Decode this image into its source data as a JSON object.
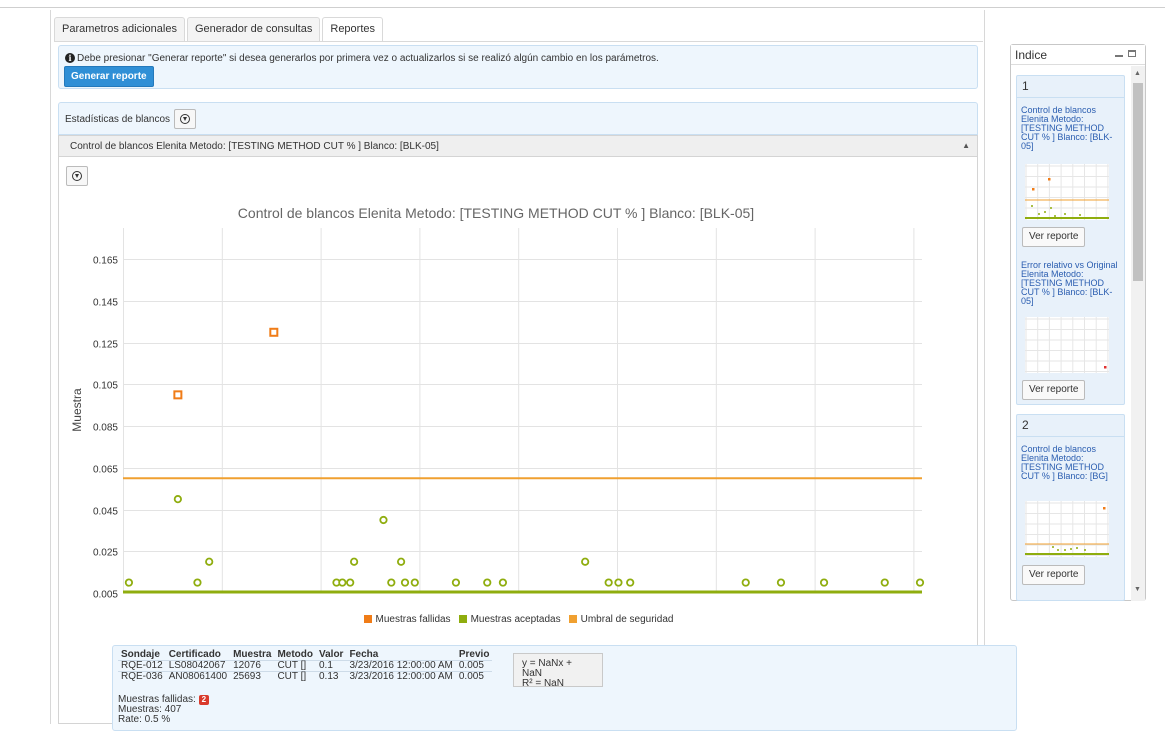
{
  "tabs": [
    {
      "label": "Parametros adicionales"
    },
    {
      "label": "Generador de consultas"
    },
    {
      "label": "Reportes"
    }
  ],
  "info": {
    "message": "Debe presionar \"Generar reporte\" si desea generarlos por primera vez o actualizarlos si se realizó algún cambio en los parámetros.",
    "button_label": "Generar reporte"
  },
  "stats": {
    "title": "Estadísticas de blancos"
  },
  "accordion": {
    "title": "Control de blancos Elenita Metodo: [TESTING METHOD CUT % ] Blanco: [BLK-05]"
  },
  "chart_data": {
    "type": "scatter",
    "title": "Control de blancos Elenita Metodo: [TESTING METHOD CUT % ] Blanco: [BLK-05]",
    "ylabel": "Muestra",
    "xlabel": "",
    "ylim": [
      0.005,
      0.18
    ],
    "y_ticks": [
      0.005,
      0.025,
      0.045,
      0.065,
      0.085,
      0.105,
      0.125,
      0.145,
      0.165
    ],
    "y_tick_labels": [
      "0.005",
      "0.025",
      "0.045",
      "0.065",
      "0.085",
      "0.105",
      "0.125",
      "0.145",
      "0.165"
    ],
    "grid": true,
    "x_count": 407,
    "legend_position": "bottom",
    "threshold": 0.06,
    "series": [
      {
        "name": "Muestras fallidas",
        "color": "#f07c17",
        "points": [
          [
            28,
            0.1
          ],
          [
            77,
            0.13
          ]
        ]
      },
      {
        "name": "Muestras aceptadas",
        "color": "#8fad0e",
        "points": [
          [
            3,
            0.01
          ],
          [
            38,
            0.01
          ],
          [
            28,
            0.05
          ],
          [
            44,
            0.02
          ],
          [
            109,
            0.01
          ],
          [
            112,
            0.01
          ],
          [
            116,
            0.01
          ],
          [
            118,
            0.02
          ],
          [
            133,
            0.04
          ],
          [
            137,
            0.01
          ],
          [
            142,
            0.02
          ],
          [
            144,
            0.01
          ],
          [
            149,
            0.01
          ],
          [
            170,
            0.01
          ],
          [
            186,
            0.01
          ],
          [
            194,
            0.01
          ],
          [
            236,
            0.02
          ],
          [
            248,
            0.01
          ],
          [
            253,
            0.01
          ],
          [
            259,
            0.01
          ],
          [
            318,
            0.01
          ],
          [
            336,
            0.01
          ],
          [
            358,
            0.01
          ],
          [
            389,
            0.01
          ],
          [
            407,
            0.01
          ]
        ]
      },
      {
        "name": "Umbral de seguridad",
        "color": "#f0a030"
      }
    ]
  },
  "legend": [
    {
      "label": "Muestras fallidas",
      "color": "#f07c17"
    },
    {
      "label": "Muestras aceptadas",
      "color": "#8fad0e"
    },
    {
      "label": "Umbral de seguridad",
      "color": "#f0a030"
    }
  ],
  "table": {
    "headers": [
      "Sondaje",
      "Certificado",
      "Muestra",
      "Metodo",
      "Valor",
      "Fecha",
      "Previo"
    ],
    "rows": [
      [
        "RQE-012",
        "LS08042067",
        "12076",
        "CUT []",
        "0.1",
        "3/23/2016 12:00:00 AM",
        "0.005"
      ],
      [
        "RQE-036",
        "AN08061400",
        "25693",
        "CUT []",
        "0.13",
        "3/23/2016 12:00:00 AM",
        "0.005"
      ]
    ]
  },
  "formula": {
    "line1": "y = NaNx + NaN",
    "line2": "R² = NaN"
  },
  "summary": {
    "failed_label": "Muestras fallidas:",
    "failed_count": "2",
    "samples": "Muestras: 407",
    "rate": "Rate: 0.5 %"
  },
  "index": {
    "title": "Indice",
    "groups": [
      {
        "number": "1",
        "items": [
          {
            "title": "Control de blancos Elenita Metodo: [TESTING METHOD CUT % ] Blanco: [BLK-05]",
            "button": "Ver reporte"
          },
          {
            "title": "Error relativo vs Original Elenita Metodo: [TESTING METHOD CUT % ] Blanco: [BLK-05]",
            "button": "Ver reporte"
          }
        ]
      },
      {
        "number": "2",
        "items": [
          {
            "title": "Control de blancos Elenita Metodo: [TESTING METHOD CUT % ] Blanco: [BG]",
            "button": "Ver reporte"
          }
        ]
      }
    ]
  }
}
